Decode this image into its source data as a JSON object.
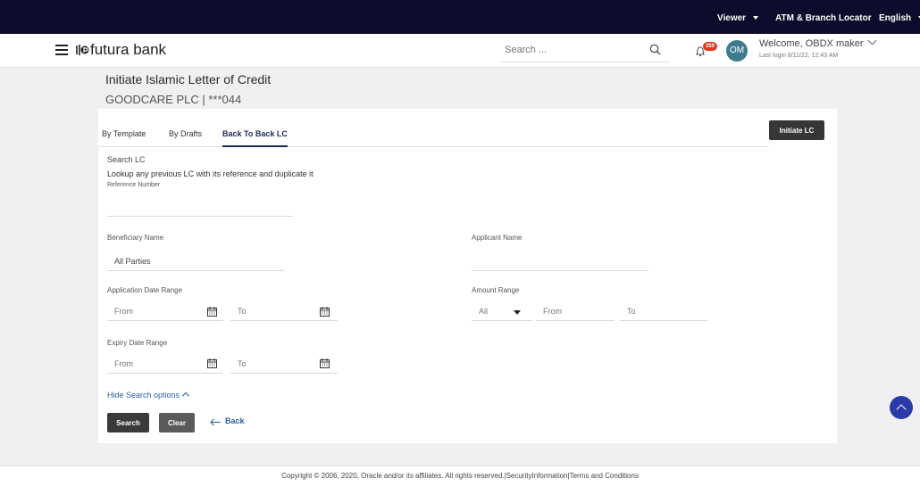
{
  "topbar": {
    "viewer": "Viewer",
    "locator": "ATM & Branch Locator",
    "language": "English"
  },
  "header": {
    "brand": "futura bank",
    "search_placeholder": "Search ...",
    "notification_count": "359",
    "avatar_initials": "OM",
    "welcome": "Welcome, OBDX maker",
    "last_login": "Last login 8/11/22, 12:43 AM"
  },
  "page": {
    "title": "Initiate Islamic Letter of Credit",
    "subtitle": "GOODCARE PLC | ***044"
  },
  "tabs": [
    {
      "label": "By Template"
    },
    {
      "label": "By Drafts"
    },
    {
      "label": "Back To Back LC"
    }
  ],
  "initiate_button": "Initiate LC",
  "search_section": {
    "heading": "Search LC",
    "description": "Lookup any previous LC with its reference and duplicate it",
    "reference_label": "Reference Number",
    "beneficiary_label": "Beneficiary Name",
    "beneficiary_value": "All Parties",
    "applicant_label": "Applicant Name",
    "application_date_label": "Application Date Range",
    "amount_range_label": "Amount Range",
    "amount_currency": "All",
    "from_placeholder": "From",
    "to_placeholder": "To",
    "expiry_date_label": "Expiry Date Range",
    "hide_link": "Hide Search options"
  },
  "actions": {
    "search": "Search",
    "clear": "Clear",
    "back": "Back"
  },
  "footer": {
    "text": "Copyright © 2006, 2020, Oracle and/or its affiliates. All rights reserved.|SecurityInformation|Terms and Conditions"
  },
  "colors": {
    "topbar": "#0c0d2c",
    "accent": "#2b5fa7",
    "button_dark": "#3a3a3a",
    "fab": "#2a3aa8"
  }
}
